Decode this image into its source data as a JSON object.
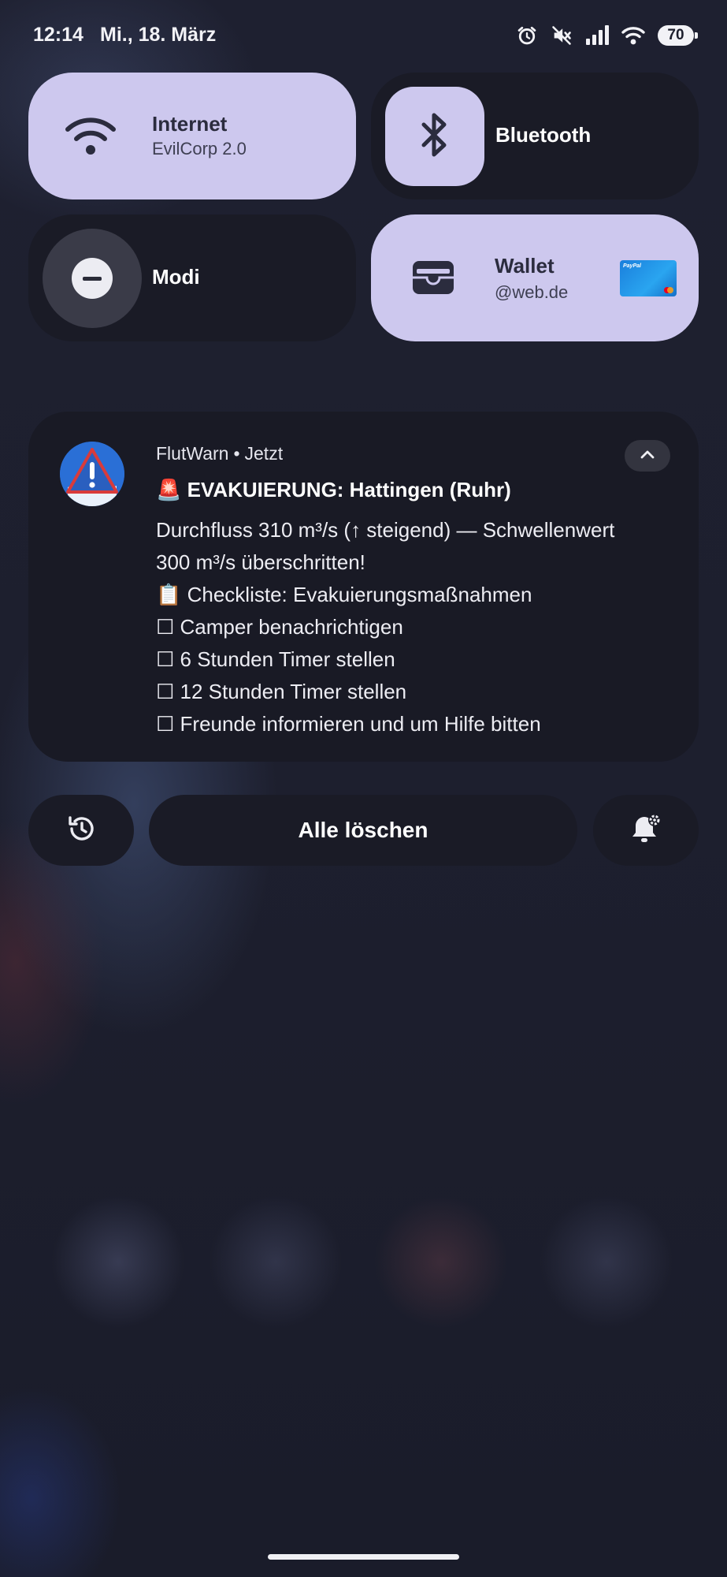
{
  "status_bar": {
    "time": "12:14",
    "date": "Mi., 18. März",
    "battery": "70",
    "icons": [
      "alarm-icon",
      "mute-icon",
      "signal-icon",
      "wifi-icon",
      "battery-icon"
    ]
  },
  "quick_settings": {
    "internet": {
      "title": "Internet",
      "subtitle": "EvilCorp 2.0",
      "state": "on",
      "icon": "wifi-icon"
    },
    "bluetooth": {
      "title": "Bluetooth",
      "state": "on",
      "icon": "bluetooth-icon"
    },
    "modi": {
      "title": "Modi",
      "state": "off",
      "icon": "do-not-disturb-icon"
    },
    "wallet": {
      "title": "Wallet",
      "subtitle": "@web.de",
      "state": "on",
      "icon": "wallet-icon",
      "card_brand": "PayPal"
    }
  },
  "notification": {
    "app_name": "FlutWarn",
    "separator": "•",
    "time": "Jetzt",
    "title": "🚨 EVAKUIERUNG: Hattingen (Ruhr)",
    "body_lines": [
      "Durchfluss 310 m³/s (↑ steigend) — Schwellenwert",
      "300 m³/s überschritten!",
      "📋 Checkliste: Evakuierungsmaßnahmen",
      "☐ Camper benachrichtigen",
      "☐ 6 Stunden Timer stellen",
      "☐ 12 Stunden Timer stellen",
      "☐ Freunde informieren und um Hilfe bitten"
    ]
  },
  "actions": {
    "clear_all": "Alle löschen"
  },
  "colors": {
    "tile_on": "#cdc8ee",
    "tile_off": "#1a1b26",
    "background": "#1c1e2c",
    "app_icon_blue": "#2a6fd6",
    "app_icon_red": "#d93b3b"
  }
}
